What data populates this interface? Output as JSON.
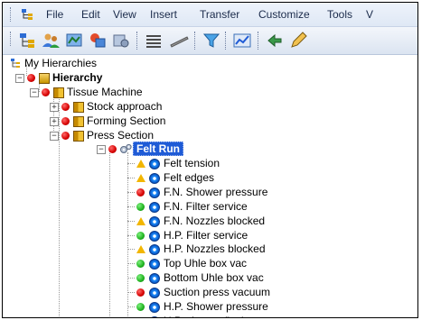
{
  "menu": {
    "items": [
      "File",
      "Edit",
      "View",
      "Insert",
      "Transfer",
      "Customize",
      "Tools",
      "V"
    ]
  },
  "toolbar": {
    "icons": [
      "hierarchy-icon",
      "users-icon",
      "map-icon",
      "transfer-icon",
      "settings-icon",
      "list-icon",
      "ruler-icon",
      "filter-icon",
      "chart-icon",
      "back-icon"
    ]
  },
  "tree": {
    "root": "My Hierarchies",
    "hierarchy": "Hierarchy",
    "tissue_machine": "Tissue Machine",
    "stock_approach": "Stock approach",
    "forming_section": "Forming Section",
    "press_section": "Press Section",
    "felt_run": "Felt Run",
    "items": [
      {
        "status": "warning",
        "label": "Felt tension"
      },
      {
        "status": "warning",
        "label": "Felt edges"
      },
      {
        "status": "alarm",
        "label": "F.N. Shower pressure"
      },
      {
        "status": "ok",
        "label": "F.N. Filter service"
      },
      {
        "status": "warning",
        "label": "F.N. Nozzles blocked"
      },
      {
        "status": "ok",
        "label": "H.P. Filter service"
      },
      {
        "status": "warning",
        "label": "H.P. Nozzles blocked"
      },
      {
        "status": "ok",
        "label": "Top Uhle box vac"
      },
      {
        "status": "ok",
        "label": "Bottom Uhle box vac"
      },
      {
        "status": "alarm",
        "label": "Suction press vacuum"
      },
      {
        "status": "ok",
        "label": "H.P. Shower pressure"
      },
      {
        "status": "ok",
        "label": "H.P. shower flush"
      }
    ]
  },
  "colors": {
    "selection": "#1f5bd6",
    "alarm": "#d60000",
    "ok": "#1fb31f",
    "warning": "#f2b600"
  }
}
